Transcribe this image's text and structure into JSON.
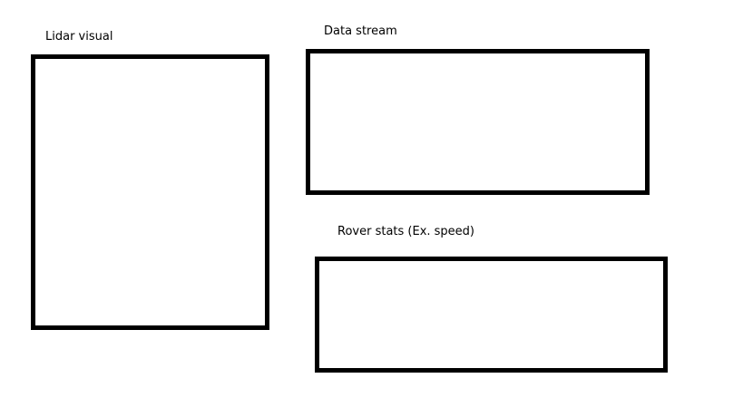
{
  "panels": {
    "lidar": {
      "label": "Lidar visual"
    },
    "data_stream": {
      "label": "Data stream"
    },
    "rover_stats": {
      "label": "Rover stats (Ex. speed)"
    }
  },
  "colors": {
    "background": "#ffffff",
    "border": "#000000",
    "text": "#000000"
  }
}
